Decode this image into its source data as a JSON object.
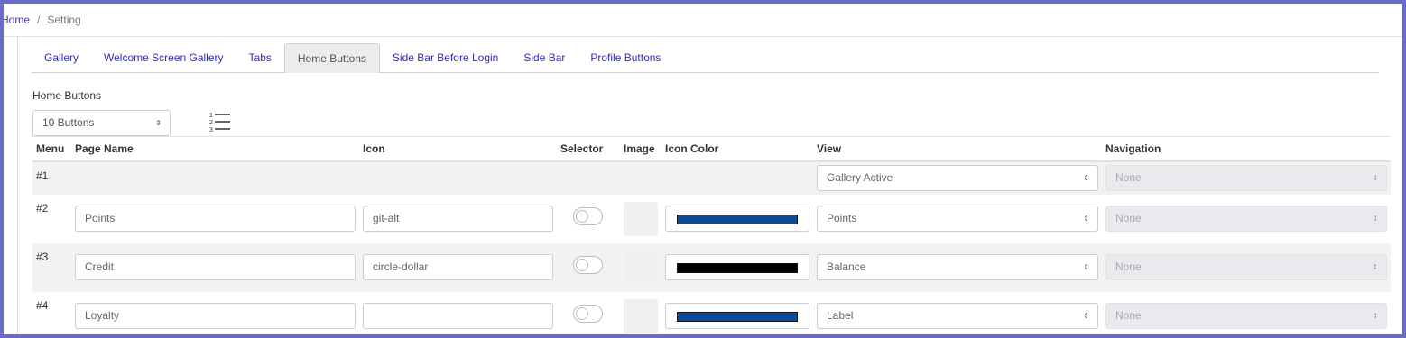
{
  "breadcrumb": {
    "home": "Home",
    "separator": "/",
    "current": "Setting"
  },
  "tabs": [
    {
      "label": "Gallery",
      "active": false
    },
    {
      "label": "Welcome Screen Gallery",
      "active": false
    },
    {
      "label": "Tabs",
      "active": false
    },
    {
      "label": "Home Buttons",
      "active": true
    },
    {
      "label": "Side Bar Before Login",
      "active": false
    },
    {
      "label": "Side Bar",
      "active": false
    },
    {
      "label": "Profile Buttons",
      "active": false
    }
  ],
  "section": {
    "label": "Home Buttons",
    "count_select": "10 Buttons",
    "list_icon": "ordered-list-icon"
  },
  "table": {
    "headers": {
      "menu": "Menu",
      "page_name": "Page Name",
      "icon": "Icon",
      "selector": "Selector",
      "image": "Image",
      "icon_color": "Icon Color",
      "view": "View",
      "navigation": "Navigation"
    },
    "rows": [
      {
        "menu": "#1",
        "page_name": null,
        "icon": null,
        "selector": null,
        "color": null,
        "view": "Gallery Active",
        "navigation": "None"
      },
      {
        "menu": "#2",
        "page_name": "Points",
        "icon": "git-alt",
        "selector": false,
        "color": "#0c4a96",
        "view": "Points",
        "navigation": "None"
      },
      {
        "menu": "#3",
        "page_name": "Credit",
        "icon": "circle-dollar",
        "selector": false,
        "color": "#000000",
        "view": "Balance",
        "navigation": "None"
      },
      {
        "menu": "#4",
        "page_name": "Loyalty",
        "icon": "",
        "selector": false,
        "color": "#0c4a96",
        "view": "Label",
        "navigation": "None"
      }
    ]
  },
  "colors": {
    "background_border": "#6a6ac8",
    "link": "#2d2dc0",
    "active_tab_bg": "#ececec"
  }
}
